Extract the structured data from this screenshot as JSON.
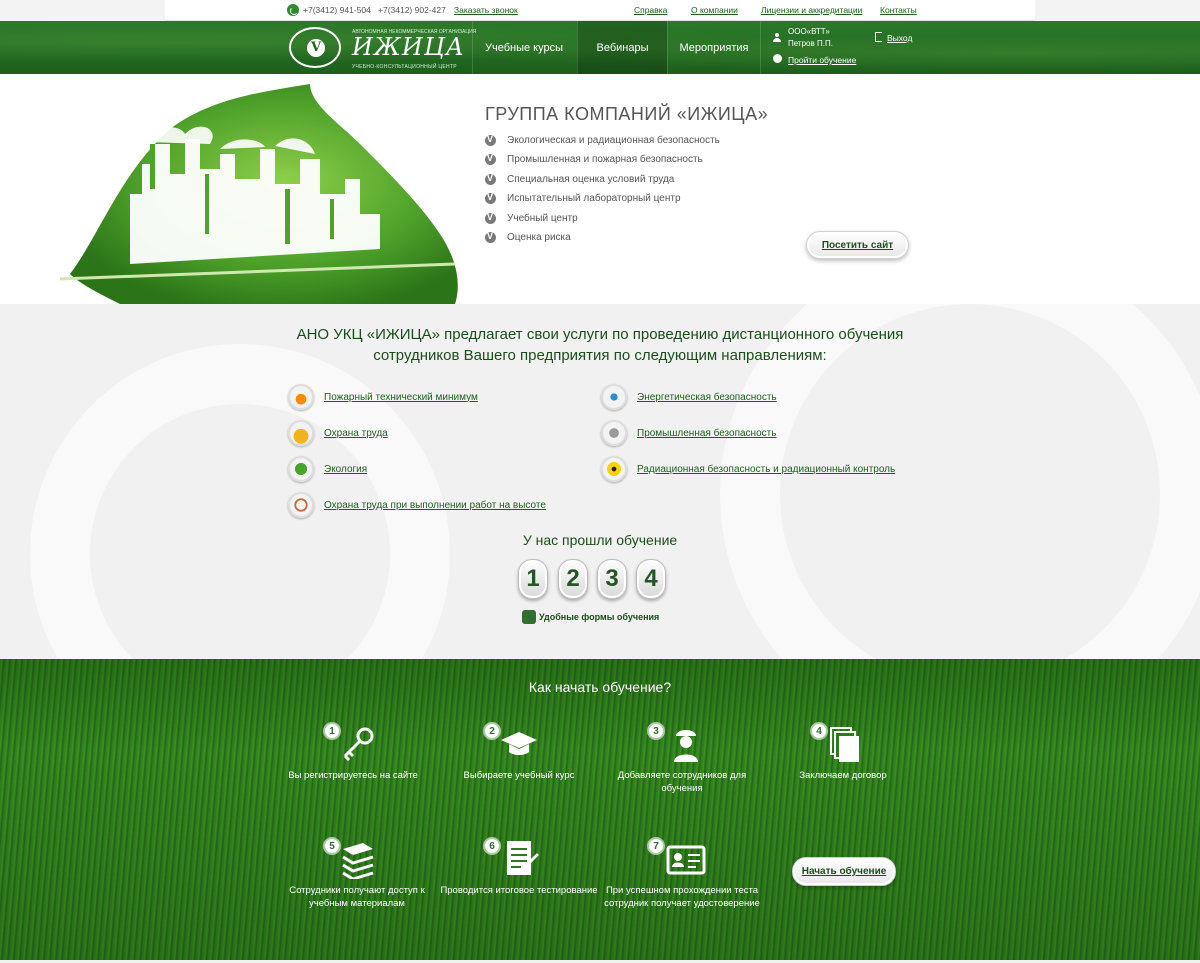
{
  "topbar": {
    "phone1": "+7(3412) 941-504",
    "phone2": "+7(3412) 902-427",
    "callback": "Заказать звонок",
    "links": [
      "Справка",
      "О компании",
      "Лицензии и аккредитации",
      "Контакты"
    ]
  },
  "header": {
    "logo_title": "ИЖИЦА",
    "logo_top": "АВТОНОМНАЯ НЕКОММЕРЧЕСКАЯ ОРГАНИЗАЦИЯ",
    "logo_sub": "УЧЕБНО-КОНСУЛЬТАЦИОННЫЙ ЦЕНТР",
    "nav": [
      "Учебные курсы",
      "Вебинары",
      "Мероприятия"
    ],
    "company": "ООО«ВТТ»",
    "user": "Петров П.П.",
    "exit": "Выход",
    "start": "Пройти обучение"
  },
  "hero": {
    "title": "ГРУППА КОМПАНИЙ «ИЖИЦА»",
    "items": [
      "Экологическая и радиационная безопасность",
      "Промышленная и пожарная безопасность",
      "Специальная оценка условий труда",
      "Испытательный лабораторный центр",
      "Учебный центр",
      "Оценка риска"
    ],
    "visit_button": "Посетить сайт"
  },
  "middle": {
    "title_line1": "АНО УКЦ «ИЖИЦА» предлагает свои услуги по проведению дистанционного обучения",
    "title_line2": "сотрудников Вашего предприятия по следующим направлениям:",
    "courses_left": [
      "Пожарный технический минимум",
      "Охрана труда",
      "Экология",
      "Охрана труда при выполнении работ на высоте"
    ],
    "courses_right": [
      "Энергетическая безопасность",
      "Промышленная безопасность",
      "Радиационная безопасность и радиационный контроль"
    ],
    "stats_title": "У нас прошли обучение",
    "digits": [
      "1",
      "2",
      "3",
      "4"
    ],
    "forms_link": "Удобные формы обучения"
  },
  "steps": {
    "title": "Как начать обучение?",
    "items": [
      {
        "num": "1",
        "text": "Вы регистрируетесь на сайте"
      },
      {
        "num": "2",
        "text": "Выбираете учебный курс"
      },
      {
        "num": "3",
        "text": "Добавляете сотрудников для обучения"
      },
      {
        "num": "4",
        "text": "Заключаем договор"
      },
      {
        "num": "5",
        "text": "Сотрудники получают доступ к учебным материалам"
      },
      {
        "num": "6",
        "text": "Проводится итоговое тестирование"
      },
      {
        "num": "7",
        "text": "При успешном прохождении теста сотрудник получает удостоверение"
      }
    ],
    "start_button": "Начать обучение"
  }
}
